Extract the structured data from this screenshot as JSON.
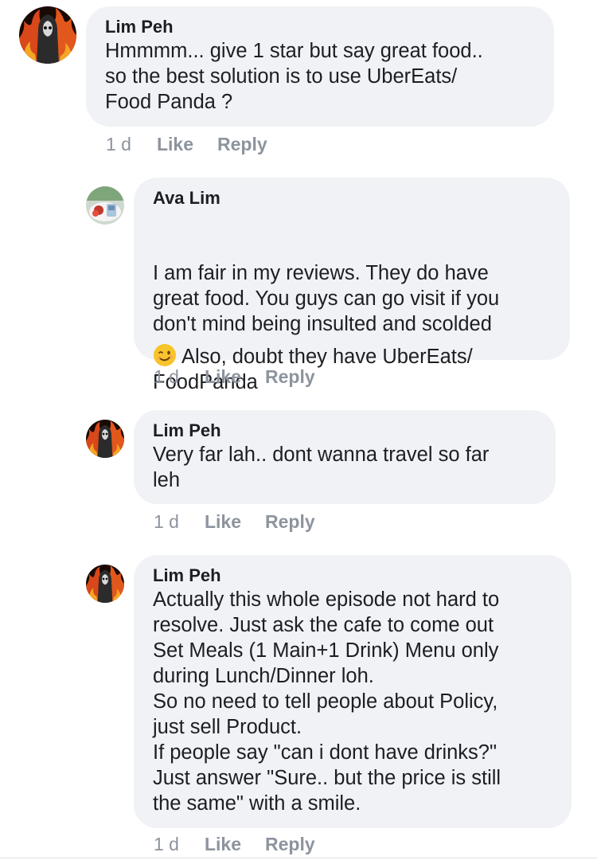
{
  "comments": [
    {
      "author": "Lim Peh",
      "text": "Hmmmm... give 1 star but say great food..\nso the best solution is to use UberEats/\nFood Panda ?",
      "time": "1 d",
      "like_label": "Like",
      "reply_label": "Reply",
      "avatar_icon": "grim-reaper-flames-avatar"
    },
    {
      "author": "Ava Lim",
      "text": "I am fair in my reviews. They do have\ngreat food. You guys can go visit if you\ndon't mind being insulted and scolded",
      "text_after_emoji": "Also, doubt they have UberEats/\nFoodPanda",
      "emoji": "winking-face-emoji",
      "time": "1 d",
      "like_label": "Like",
      "reply_label": "Reply",
      "avatar_icon": "food-photo-avatar"
    },
    {
      "author": "Lim Peh",
      "text": "Very far lah.. dont wanna travel so far\nleh",
      "time": "1 d",
      "like_label": "Like",
      "reply_label": "Reply",
      "avatar_icon": "grim-reaper-flames-avatar"
    },
    {
      "author": "Lim Peh",
      "text": "Actually this whole episode not hard to\nresolve. Just ask the cafe to come out\nSet Meals (1 Main+1 Drink) Menu only\nduring Lunch/Dinner loh.\nSo no need to tell people about Policy,\njust sell Product.\nIf people say \"can i dont have drinks?\"\nJust answer \"Sure.. but the price is still\nthe same\" with a smile.",
      "time": "1 d",
      "like_label": "Like",
      "reply_label": "Reply",
      "avatar_icon": "grim-reaper-flames-avatar"
    }
  ],
  "colors": {
    "bubble_bg": "#f0f2f5",
    "meta_text": "#8d949e",
    "text": "#1c1e21"
  }
}
